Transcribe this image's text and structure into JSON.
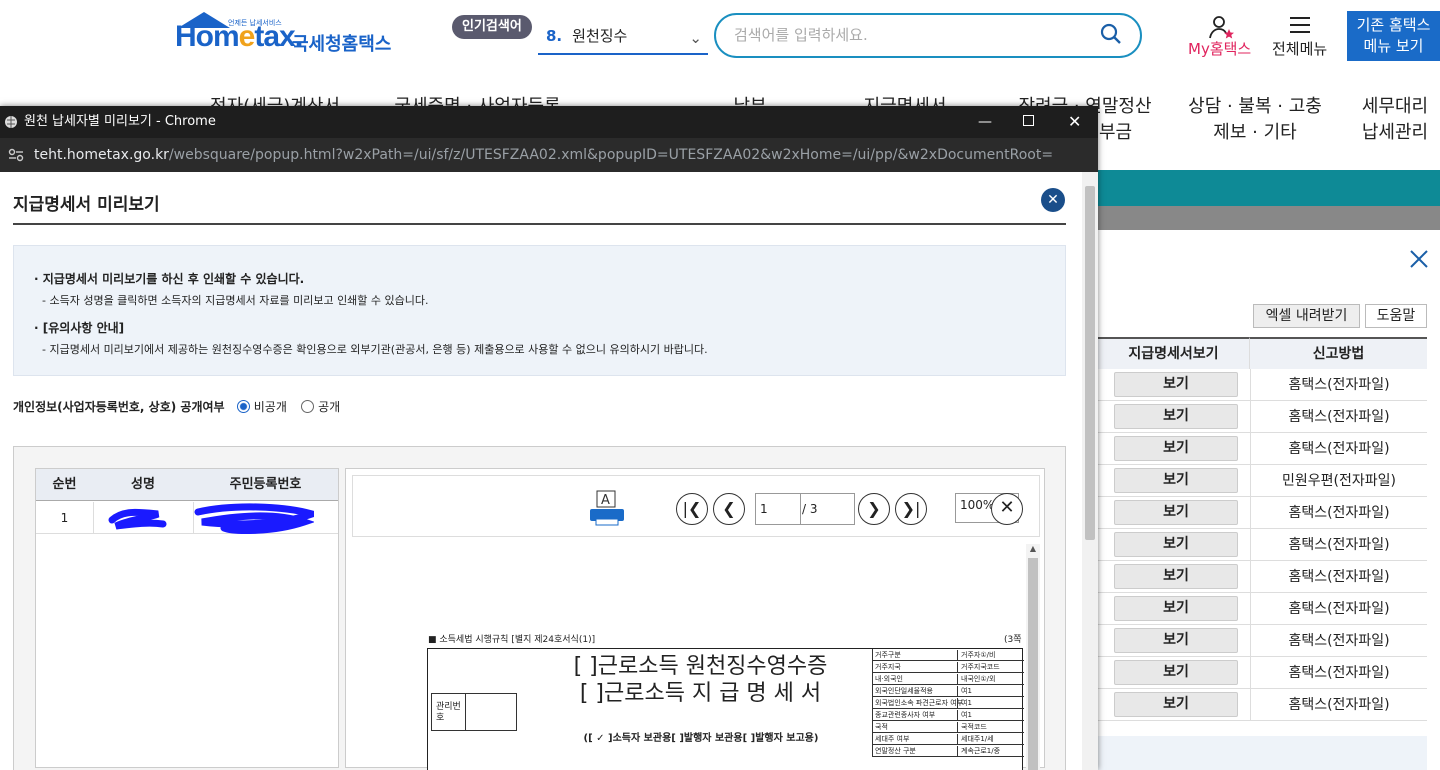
{
  "header": {
    "logo_en_pre": "Hom",
    "logo_en_e": "e",
    "logo_en_post": "tax.",
    "logo_tiny": "언제든 납세서비스",
    "logo_ko": "국세청홈택스",
    "popular_badge": "인기검색어",
    "popular_num": "8.",
    "popular_term": "원천징수",
    "search_placeholder": "검색어를 입력하세요.",
    "my_label": "My홈택스",
    "menu_label": "전체메뉴",
    "old_btn_line1": "기존 홈택스",
    "old_btn_line2": "메뉴 보기",
    "nav": [
      {
        "l1": "전자(세금)계산서",
        "l2": ""
      },
      {
        "l1": "국세증명 · 사업자등록",
        "l2": ""
      },
      {
        "l1": "납부",
        "l2": ""
      },
      {
        "l1": "지급명세서",
        "l2": ""
      },
      {
        "l1": "장려금 · 연말정산",
        "l2": "· 전자기부금"
      },
      {
        "l1": "상담 · 불복 · 고충",
        "l2": "제보 · 기타"
      },
      {
        "l1": "세무대리",
        "l2": "납세관리"
      }
    ]
  },
  "background": {
    "excel_btn": "엑셀 내려받기",
    "help_btn": "도움말",
    "col_view": "지급명세서보기",
    "col_method": "신고방법",
    "rows": [
      {
        "btn": "보기",
        "method": "홈택스(전자파일)"
      },
      {
        "btn": "보기",
        "method": "홈택스(전자파일)"
      },
      {
        "btn": "보기",
        "method": "홈택스(전자파일)"
      },
      {
        "btn": "보기",
        "method": "민원우편(전자파일)"
      },
      {
        "btn": "보기",
        "method": "홈택스(전자파일)"
      },
      {
        "btn": "보기",
        "method": "홈택스(전자파일)"
      },
      {
        "btn": "보기",
        "method": "홈택스(전자파일)"
      },
      {
        "btn": "보기",
        "method": "홈택스(전자파일)"
      },
      {
        "btn": "보기",
        "method": "홈택스(전자파일)"
      },
      {
        "btn": "보기",
        "method": "홈택스(전자파일)"
      },
      {
        "btn": "보기",
        "method": "홈택스(전자파일)"
      }
    ]
  },
  "popup": {
    "window_title": "원천 납세자별 미리보기 - Chrome",
    "url_host": "teht.hometax.go.kr",
    "url_path": "/websquare/popup.html?w2xPath=/ui/sf/z/UTESFZAA02.xml&popupID=UTESFZAA02&w2xHome=/ui/pp/&w2xDocumentRoot=",
    "page_title": "지급명세서 미리보기",
    "info_h1": "지급명세서 미리보기를 하신 후 인쇄할 수 있습니다.",
    "info_t1": "소득자 성명을 클릭하면 소득자의 지급명세서 자료를 미리보고 인쇄할 수 있습니다.",
    "info_h2": "[유의사항 안내]",
    "info_t2": "지급명세서 미리보기에서 제공하는 원천징수영수증은 확인용으로 외부기관(관공서, 은행 등) 제출용으로 사용할 수 없으니 유의하시기 바랍니다.",
    "privacy_label": "개인정보(사업자등록번호, 상호) 공개여부",
    "privacy_opt_private": "비공개",
    "privacy_opt_public": "공개",
    "list_headers": [
      "순번",
      "성명",
      "주민등록번호"
    ],
    "list_row_no": "1",
    "viewer_page": "1",
    "viewer_total": "/ 3",
    "viewer_zoom": "100%",
    "doc_header_left": "■ 소득세법 시행규칙 [별지 제24호서식(1)]",
    "doc_header_right": "(3쪽",
    "doc_title1": "[  ]근로소득 원천징수영수증",
    "doc_title2": "[  ]근로소득 지 급 명 세 서",
    "doc_sub": "([ ✓ ]소득자 보관용[      ]발행자 보관용[      ]발행자 보고용)",
    "doc_mgmt": "관리번호",
    "doc_fields": [
      "거주구분",
      "거주자①/비",
      "거주지국",
      "거주지국코드",
      "내·외국인",
      "내국인①/외",
      "외국인단일세율적용",
      "여1",
      "외국법인소속 파견근로자 여부",
      "여1",
      "종교관련종사자 여부",
      "여1",
      "국적",
      "국적코드",
      "세대주 여부",
      "세대주1/세",
      "연말정산 구분",
      "계속근로1/중"
    ]
  }
}
